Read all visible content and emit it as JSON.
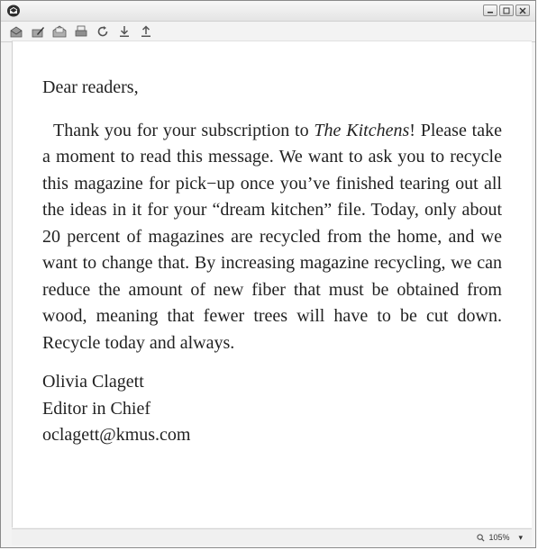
{
  "window": {
    "controls": [
      "minimize",
      "maximize",
      "close"
    ]
  },
  "toolbar": {
    "icons": [
      "inbox-icon",
      "compose-icon",
      "read-mail-icon",
      "print-icon",
      "refresh-icon",
      "download-icon",
      "upload-icon"
    ]
  },
  "letter": {
    "greeting": "Dear readers,",
    "body_before_title": "Thank you for your subscription to ",
    "magazine_title": "The Kitchens",
    "body_after_title": "! Please take a moment to read this message. We want to ask you to recycle this magazine for pick−up once you’ve finished tearing out all the ideas in it for your “dream kitchen” file. Today, only about 20 percent of magazines are recycled from the home, and we want to change that. By increasing magazine recycling, we can reduce the amount of new fiber that must be obtained from wood, meaning that fewer trees will have to be cut down. Recycle today and always.",
    "signature_name": "Olivia Clagett",
    "signature_title": "Editor in Chief",
    "signature_email": "oclagett@kmus.com"
  },
  "status": {
    "zoom": "105%"
  }
}
